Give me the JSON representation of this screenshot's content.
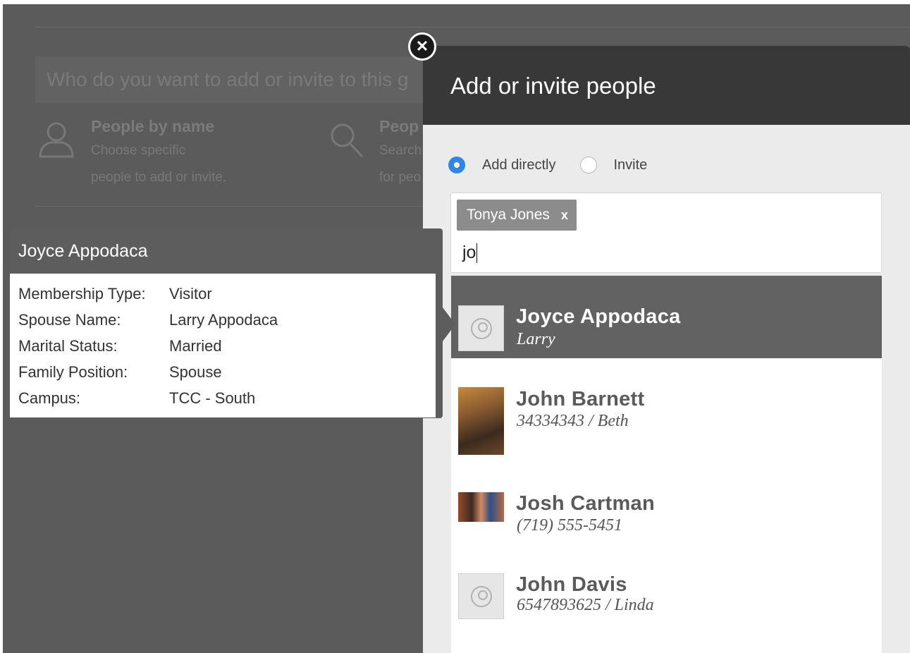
{
  "background": {
    "search_prompt": "Who do you want to add or invite to this g",
    "option_name": {
      "title": "People by name",
      "line1": "Choose specific",
      "line2": "people to add or invite."
    },
    "option_search": {
      "title": "Peop",
      "line1": "Search",
      "line2": "for peo"
    }
  },
  "modal": {
    "title": "Add or invite people",
    "close_icon": "close-icon",
    "radio_add_label": "Add directly",
    "radio_invite_label": "Invite",
    "selected_mode": "Add directly",
    "token": {
      "label": "Tonya Jones",
      "remove": "x"
    },
    "search_value": "jo",
    "results": [
      {
        "name": "Joyce Appodaca",
        "sub": "Larry",
        "avatar": "generic-person-icon",
        "selected": true
      },
      {
        "name": "John Barnett",
        "sub": "34334343 / Beth",
        "avatar": "photo"
      },
      {
        "name": "Josh Cartman",
        "sub": "(719) 555-5451",
        "avatar": "photo"
      },
      {
        "name": "John Davis",
        "sub": "6547893625 / Linda",
        "avatar": "generic-person-icon"
      }
    ]
  },
  "popover": {
    "title": "Joyce Appodaca",
    "rows": [
      {
        "label": "Membership Type:",
        "value": "Visitor"
      },
      {
        "label": "Spouse Name:",
        "value": "Larry Appodaca"
      },
      {
        "label": "Marital Status:",
        "value": "Married"
      },
      {
        "label": "Family Position:",
        "value": "Spouse"
      },
      {
        "label": "Campus:",
        "value": "TCC - South"
      }
    ]
  },
  "colors": {
    "overlay": "#5b5b5b",
    "modal_header": "#383838",
    "accent_radio": "#2f86e8",
    "selected_row": "#626262"
  }
}
